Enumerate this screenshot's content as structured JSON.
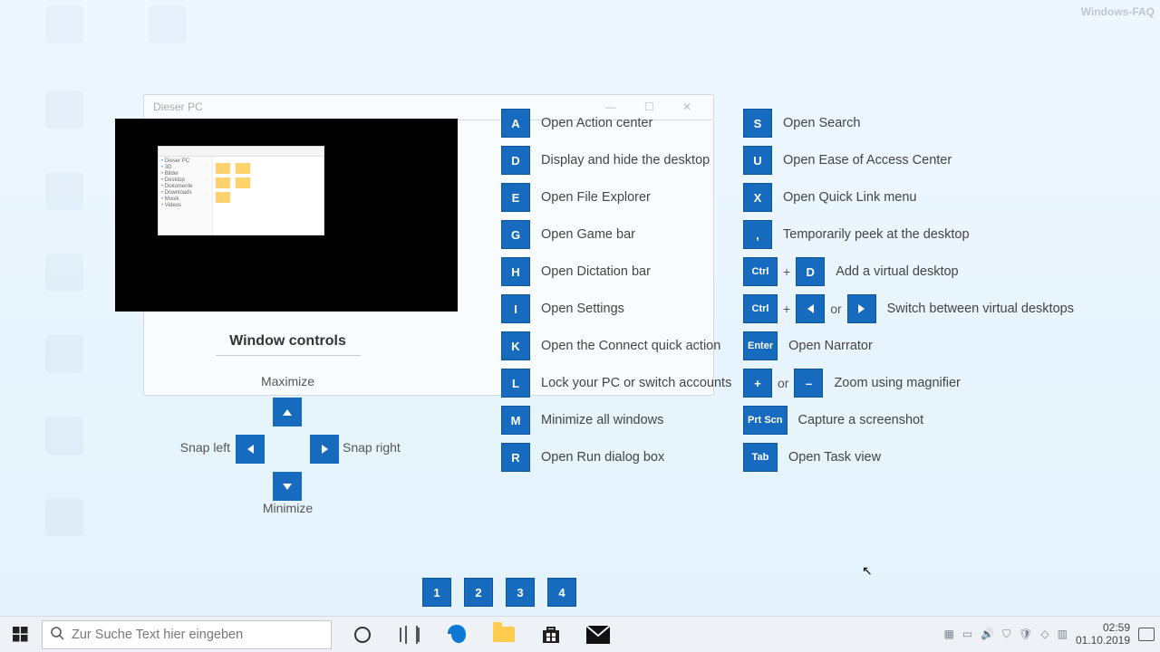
{
  "watermark": "Windows-FAQ",
  "desktop_icons": [
    "",
    "",
    "",
    "",
    "",
    "",
    "",
    ""
  ],
  "ghost_window": {
    "title": "Dieser PC"
  },
  "window_controls": {
    "title": "Window controls",
    "maximize": "Maximize",
    "minimize": "Minimize",
    "snap_left": "Snap left",
    "snap_right": "Snap right"
  },
  "col1": [
    {
      "key": "A",
      "desc": "Open Action center"
    },
    {
      "key": "D",
      "desc": "Display and hide the desktop"
    },
    {
      "key": "E",
      "desc": "Open File Explorer"
    },
    {
      "key": "G",
      "desc": "Open Game bar"
    },
    {
      "key": "H",
      "desc": "Open Dictation bar"
    },
    {
      "key": "I",
      "desc": "Open Settings"
    },
    {
      "key": "K",
      "desc": "Open the Connect quick action"
    },
    {
      "key": "L",
      "desc": "Lock your PC or switch accounts"
    },
    {
      "key": "M",
      "desc": "Minimize all windows"
    },
    {
      "key": "R",
      "desc": "Open Run dialog box"
    }
  ],
  "col2_simple": [
    {
      "key": "S",
      "desc": "Open Search"
    },
    {
      "key": "U",
      "desc": "Open Ease of Access Center"
    },
    {
      "key": "X",
      "desc": "Open Quick Link menu"
    },
    {
      "key": ",",
      "desc": "Temporarily peek at the desktop"
    }
  ],
  "col2_complex": {
    "ctrl_d": {
      "k1": "Ctrl",
      "sep": "+",
      "k2": "D",
      "desc": "Add a virtual desktop"
    },
    "ctrl_arrows": {
      "k1": "Ctrl",
      "sep1": "+",
      "sep2": "or",
      "desc": "Switch between virtual desktops"
    },
    "enter": {
      "k1": "Enter",
      "desc": "Open Narrator"
    },
    "plus_minus": {
      "k1": "+",
      "sep": "or",
      "k2": "–",
      "desc": "Zoom using magnifier"
    },
    "prtscn": {
      "k1": "Prt Scn",
      "desc": "Capture a screenshot"
    },
    "tab": {
      "k1": "Tab",
      "desc": "Open Task view"
    }
  },
  "numbers": [
    "1",
    "2",
    "3",
    "4"
  ],
  "taskbar": {
    "search_placeholder": "Zur Suche Text hier eingeben",
    "time": "02:59",
    "date": "01.10.2019"
  }
}
